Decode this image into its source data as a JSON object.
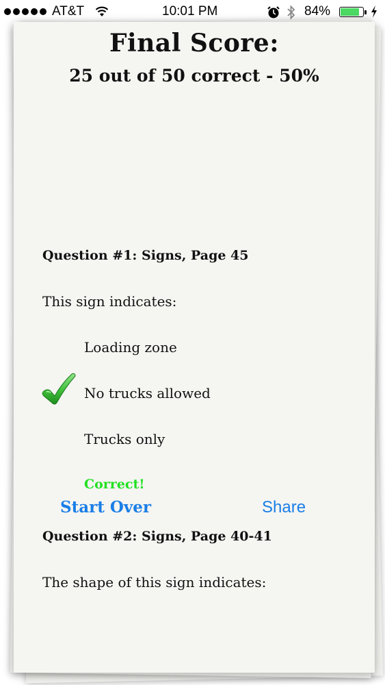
{
  "status_bar": {
    "carrier": "AT&T",
    "time": "10:01 PM",
    "battery_percent": "84%",
    "battery_level": 0.84,
    "icons": [
      "signal-icon",
      "wifi-icon",
      "alarm-icon",
      "bluetooth-icon",
      "battery-icon",
      "charging-icon"
    ]
  },
  "score": {
    "title": "Final Score:",
    "summary": "25 out of 50 correct - 50%"
  },
  "questions": [
    {
      "header": "Question #1: Signs, Page 45",
      "text": "This sign indicates:",
      "answers": [
        "Loading zone",
        "No trucks allowed",
        "Trucks only"
      ],
      "selected_answer": "No trucks allowed",
      "result": "Correct!"
    },
    {
      "header": "Question #2: Signs, Page 40-41",
      "text": "The shape of this sign indicates:"
    }
  ],
  "actions": {
    "start_over": "Start Over",
    "share": "Share"
  },
  "colors": {
    "link_blue": "#1a7ee6",
    "correct_green": "#22e022",
    "paper": "#f5f5f2"
  }
}
